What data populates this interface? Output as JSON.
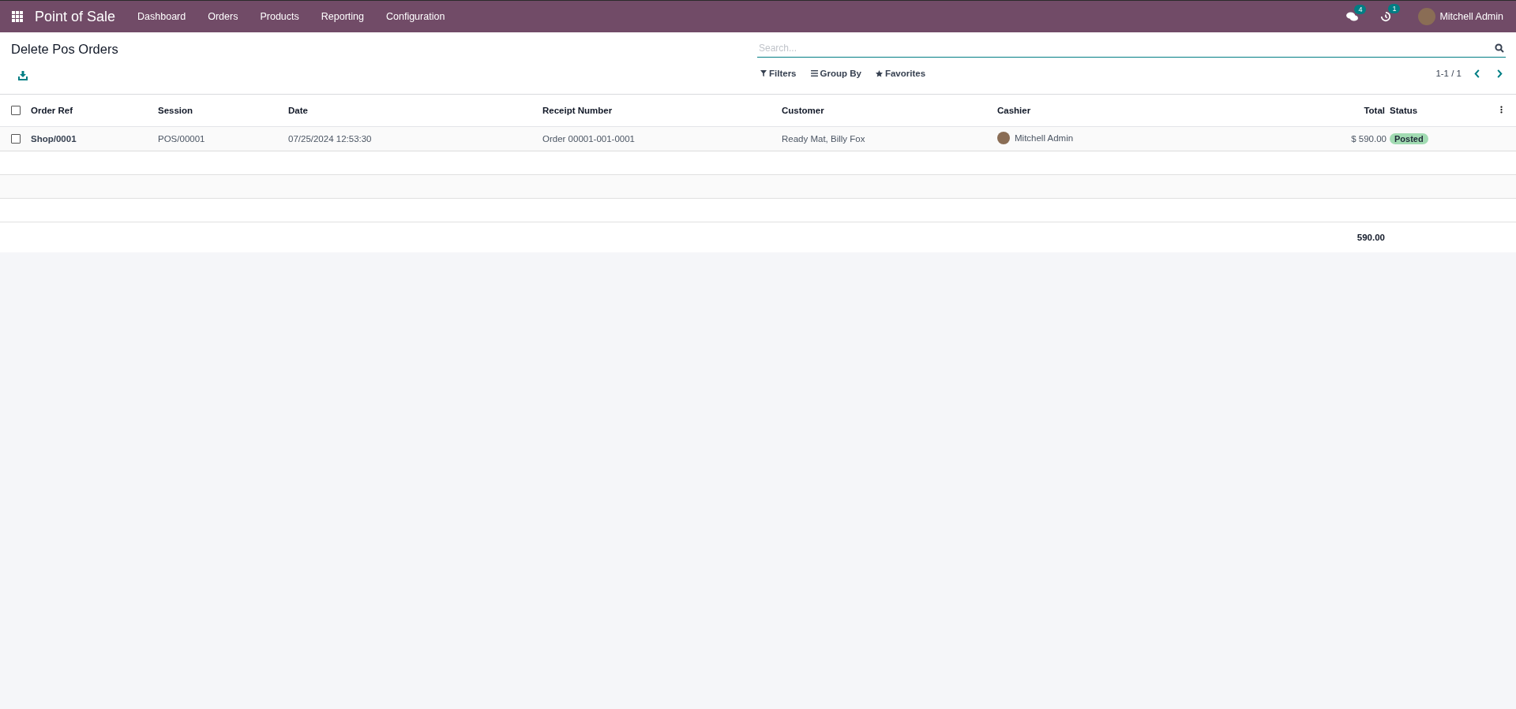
{
  "navbar": {
    "app_title": "Point of Sale",
    "menu": [
      "Dashboard",
      "Orders",
      "Products",
      "Reporting",
      "Configuration"
    ],
    "messages_count": "4",
    "activities_count": "1",
    "user": "Mitchell Admin"
  },
  "control_panel": {
    "title": "Delete Pos Orders",
    "search": {
      "placeholder": "Search..."
    },
    "filters": [
      "Filters",
      "Group By",
      "Favorites"
    ],
    "pager": "1-1 / 1"
  },
  "table": {
    "select_all_checked": false,
    "columns": [
      "Order Ref",
      "Session",
      "Date",
      "Receipt Number",
      "Customer",
      "Cashier",
      "Total",
      "Status"
    ],
    "rows": [
      {
        "checked": false,
        "order_ref": "Shop/0001",
        "session": "POS/00001",
        "date": "07/25/2024 12:53:30",
        "receipt_number": "Order 00001-001-0001",
        "customer": "Ready Mat, Billy Fox",
        "cashier": "Mitchell Admin",
        "total": "$ 590.00",
        "status": {
          "label": "Posted",
          "color": "#a1dbb2"
        }
      }
    ],
    "footer_total": "590.00"
  }
}
